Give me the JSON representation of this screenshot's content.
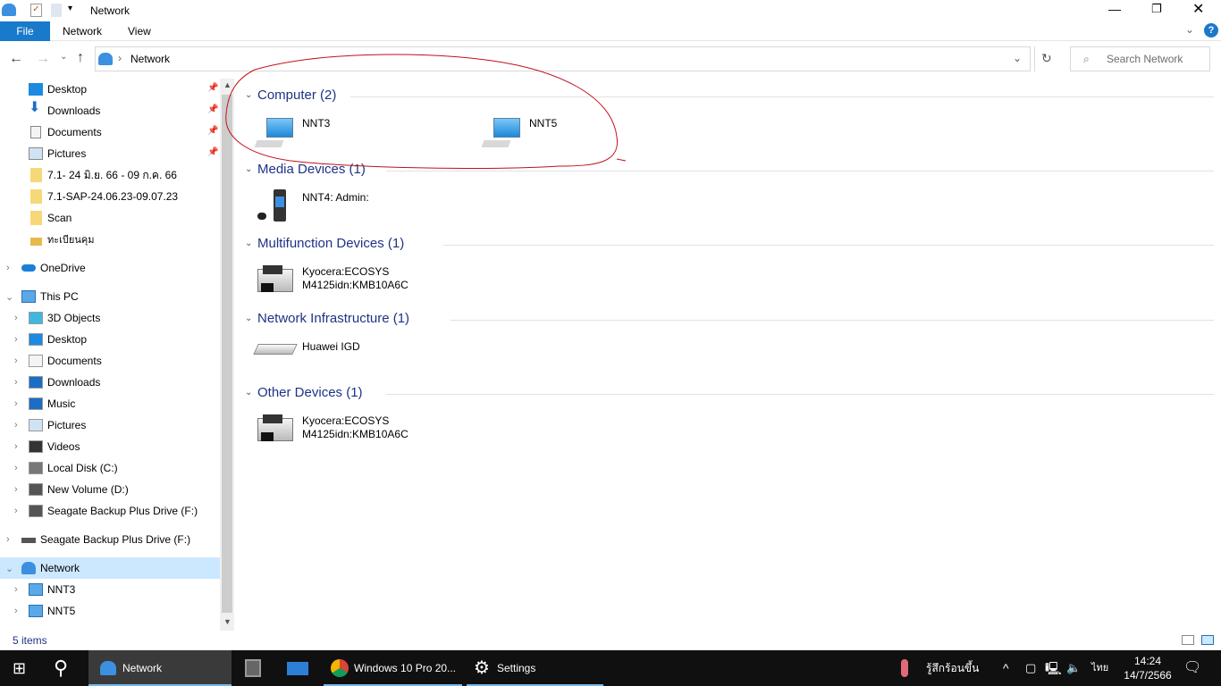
{
  "window": {
    "title": "Network",
    "ribbon_tabs": [
      "File",
      "Network",
      "View"
    ]
  },
  "address": {
    "path": "Network",
    "search_placeholder": "Search Network"
  },
  "nav": {
    "quick": [
      {
        "label": "Desktop",
        "pinned": true
      },
      {
        "label": "Downloads",
        "pinned": true
      },
      {
        "label": "Documents",
        "pinned": true
      },
      {
        "label": "Pictures",
        "pinned": true
      },
      {
        "label": "7.1- 24 มิ.ย. 66 - 09 ก.ค. 66"
      },
      {
        "label": "7.1-SAP-24.06.23-09.07.23"
      },
      {
        "label": "Scan"
      },
      {
        "label": "ทะเบียนคุม"
      }
    ],
    "onedrive": "OneDrive",
    "thispc": "This PC",
    "pc_items": [
      "3D Objects",
      "Desktop",
      "Documents",
      "Downloads",
      "Music",
      "Pictures",
      "Videos",
      "Local Disk (C:)",
      "New Volume (D:)",
      "Seagate Backup Plus Drive (F:)"
    ],
    "seagate": "Seagate Backup Plus Drive (F:)",
    "network": "Network",
    "network_items": [
      "NNT3",
      "NNT5"
    ]
  },
  "groups": [
    {
      "title": "Computer (2)",
      "items": [
        {
          "name": "NNT3",
          "icon": "computer-icon"
        },
        {
          "name": "NNT5",
          "icon": "computer-icon"
        }
      ]
    },
    {
      "title": "Media Devices (1)",
      "items": [
        {
          "name": "NNT4: Admin:",
          "icon": "media-player-icon"
        }
      ]
    },
    {
      "title": "Multifunction Devices (1)",
      "items": [
        {
          "name": "Kyocera:ECOSYS\nM4125idn:KMB10A6C",
          "icon": "printer-icon"
        }
      ]
    },
    {
      "title": "Network Infrastructure (1)",
      "items": [
        {
          "name": "Huawei IGD",
          "icon": "router-icon"
        }
      ]
    },
    {
      "title": "Other Devices (1)",
      "items": [
        {
          "name": "Kyocera:ECOSYS\nM4125idn:KMB10A6C",
          "icon": "printer-icon"
        }
      ]
    }
  ],
  "status": {
    "count": "5 items"
  },
  "taskbar": {
    "apps": [
      "Network",
      "",
      "",
      "Windows 10 Pro 20...",
      "Settings"
    ],
    "weather": "รู้สึกร้อนขึ้น",
    "lang": "ไทย",
    "time": "14:24",
    "date": "14/7/2566"
  },
  "colors": {
    "accent": "#0078d7",
    "file_tab": "#1979ca",
    "selected": "#cce8ff",
    "annotation": "#c0101a"
  }
}
